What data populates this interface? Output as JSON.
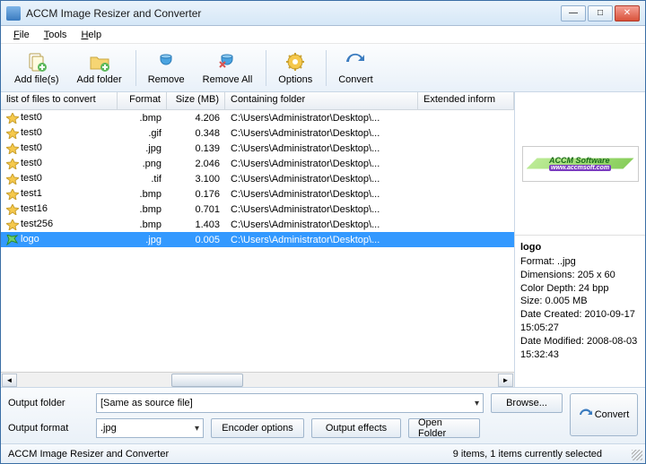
{
  "title": "ACCM Image Resizer and Converter",
  "menubar": [
    "File",
    "Tools",
    "Help"
  ],
  "toolbar": [
    {
      "id": "add-files",
      "label": "Add file(s)",
      "icon": "add-files-icon"
    },
    {
      "id": "add-folder",
      "label": "Add folder",
      "icon": "add-folder-icon"
    },
    {
      "sep": true
    },
    {
      "id": "remove",
      "label": "Remove",
      "icon": "remove-icon"
    },
    {
      "id": "remove-all",
      "label": "Remove All",
      "icon": "remove-all-icon"
    },
    {
      "sep": true
    },
    {
      "id": "options",
      "label": "Options",
      "icon": "options-icon"
    },
    {
      "sep": true
    },
    {
      "id": "convert",
      "label": "Convert",
      "icon": "convert-icon"
    }
  ],
  "columns": {
    "file": "list of files to convert",
    "format": "Format",
    "size": "Size (MB)",
    "folder": "Containing folder",
    "ext": "Extended inform"
  },
  "rows": [
    {
      "name": "test0",
      "fmt": ".bmp",
      "size": "4.206",
      "folder": "C:\\Users\\Administrator\\Desktop\\...",
      "sel": false
    },
    {
      "name": "test0",
      "fmt": ".gif",
      "size": "0.348",
      "folder": "C:\\Users\\Administrator\\Desktop\\...",
      "sel": false
    },
    {
      "name": "test0",
      "fmt": ".jpg",
      "size": "0.139",
      "folder": "C:\\Users\\Administrator\\Desktop\\...",
      "sel": false
    },
    {
      "name": "test0",
      "fmt": ".png",
      "size": "2.046",
      "folder": "C:\\Users\\Administrator\\Desktop\\...",
      "sel": false
    },
    {
      "name": "test0",
      "fmt": ".tif",
      "size": "3.100",
      "folder": "C:\\Users\\Administrator\\Desktop\\...",
      "sel": false
    },
    {
      "name": "test1",
      "fmt": ".bmp",
      "size": "0.176",
      "folder": "C:\\Users\\Administrator\\Desktop\\...",
      "sel": false
    },
    {
      "name": "test16",
      "fmt": ".bmp",
      "size": "0.701",
      "folder": "C:\\Users\\Administrator\\Desktop\\...",
      "sel": false
    },
    {
      "name": "test256",
      "fmt": ".bmp",
      "size": "1.403",
      "folder": "C:\\Users\\Administrator\\Desktop\\...",
      "sel": false
    },
    {
      "name": "logo",
      "fmt": ".jpg",
      "size": "0.005",
      "folder": "C:\\Users\\Administrator\\Desktop\\...",
      "sel": true
    }
  ],
  "preview": {
    "logo_text": "ACCM Software",
    "logo_sub": "www.accmsoft.com"
  },
  "info": {
    "name": "logo",
    "lines": [
      "Format: ..jpg",
      "Dimensions: 205 x 60",
      "Color Depth: 24 bpp",
      "Size: 0.005 MB",
      "Date Created: 2010-09-17 15:05:27",
      "Date Modified: 2008-08-03 15:32:43"
    ]
  },
  "bottom": {
    "output_folder_label": "Output folder",
    "output_folder_value": "[Same as source file]",
    "browse": "Browse...",
    "output_format_label": "Output format",
    "output_format_value": ".jpg",
    "encoder": "Encoder options",
    "effects": "Output effects",
    "open_folder": "Open Folder",
    "convert": "Convert"
  },
  "status": {
    "left": "ACCM Image Resizer and Converter",
    "right": "9 items, 1 items currently selected"
  }
}
